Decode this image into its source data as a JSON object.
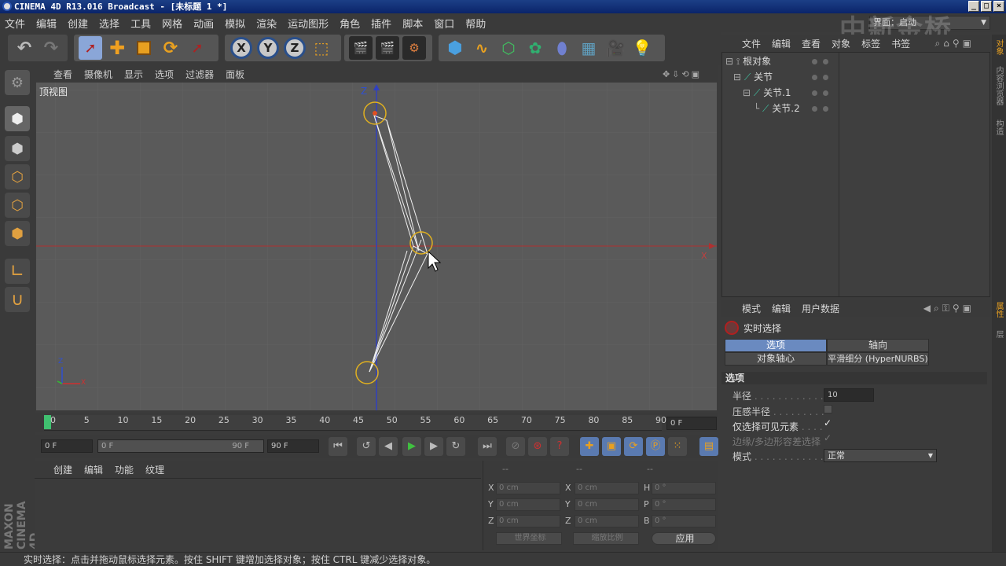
{
  "window": {
    "title": "CINEMA 4D R13.016 Broadcast - [未标题 1 *]",
    "layout_label": "界面：",
    "layout_value": "启动"
  },
  "menu": [
    "文件",
    "编辑",
    "创建",
    "选择",
    "工具",
    "网格",
    "动画",
    "模拟",
    "渲染",
    "运动图形",
    "角色",
    "插件",
    "脚本",
    "窗口",
    "帮助"
  ],
  "viewport": {
    "menu": [
      "查看",
      "摄像机",
      "显示",
      "选项",
      "过滤器",
      "面板"
    ],
    "view_name": "顶视图",
    "axis_z": "Z",
    "axis_x": "X",
    "mini_axis_z": "Z",
    "mini_axis_x": "X"
  },
  "timeline": {
    "ticks": [
      "0",
      "5",
      "10",
      "15",
      "20",
      "25",
      "30",
      "35",
      "40",
      "45",
      "50",
      "55",
      "60",
      "65",
      "70",
      "75",
      "80",
      "85",
      "90"
    ],
    "frame_display": "0 F"
  },
  "transport": {
    "current_frame": "0 F",
    "range_start": "0 F",
    "range_end": "90 F",
    "max_frame": "90 F"
  },
  "material_panel": {
    "menu": [
      "创建",
      "编辑",
      "功能",
      "纹理"
    ]
  },
  "coordinates": {
    "headers": [
      "--",
      "--",
      "--"
    ],
    "rows": [
      {
        "l1": "X",
        "v1": "0 cm",
        "l2": "X",
        "v2": "0 cm",
        "l3": "H",
        "v3": "0 °"
      },
      {
        "l1": "Y",
        "v1": "0 cm",
        "l2": "Y",
        "v2": "0 cm",
        "l3": "P",
        "v3": "0 °"
      },
      {
        "l1": "Z",
        "v1": "0 cm",
        "l2": "Z",
        "v2": "0 cm",
        "l3": "B",
        "v3": "0 °"
      }
    ],
    "world_coords": "世界坐标",
    "scale_mode": "缩放比例",
    "apply": "应用"
  },
  "object_manager": {
    "menu": [
      "文件",
      "编辑",
      "查看",
      "对象",
      "标签",
      "书签"
    ],
    "items": [
      "根对象",
      "关节",
      "关节.1",
      "关节.2"
    ]
  },
  "attributes": {
    "menu": [
      "模式",
      "编辑",
      "用户数据"
    ],
    "tool_name": "实时选择",
    "tabs": [
      "选项",
      "轴向",
      "对象轴心",
      "平滑细分 (HyperNURBS)"
    ],
    "section": "选项",
    "radius_label": "半径",
    "radius_value": "10",
    "pressure_label": "压感半径",
    "visible_only_label": "仅选择可见元素",
    "tolerance_label": "边缘/多边形容差选择",
    "mode_label": "模式",
    "mode_value": "正常"
  },
  "right_tabs": [
    "对象",
    "内容浏览器",
    "构造",
    "属性",
    "层"
  ],
  "status": "实时选择：点击并拖动鼠标选择元素。按住 SHIFT 键增加选择对象；按住 CTRL 键减少选择对象。",
  "brand": "MAXON CINEMA 4D",
  "watermark": "中新金桥"
}
